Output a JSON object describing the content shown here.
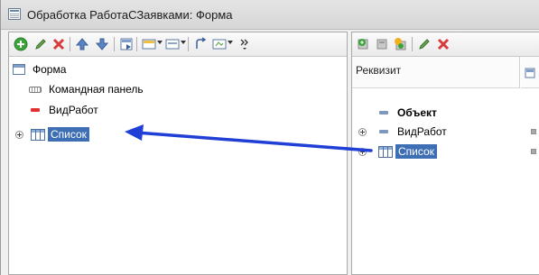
{
  "window": {
    "title": "Обработка РаботаСЗаявками: Форма"
  },
  "left_tree": {
    "items": [
      {
        "label": "Форма",
        "icon": "form-icon"
      },
      {
        "label": "Командная панель",
        "icon": "command-panel-icon"
      },
      {
        "label": "ВидРабот",
        "icon": "field-icon"
      },
      {
        "label": "Список",
        "icon": "table-icon",
        "selected": true
      }
    ]
  },
  "right_panel": {
    "column_header": "Реквизит",
    "items": [
      {
        "label": "Объект",
        "icon": "attribute-icon"
      },
      {
        "label": "ВидРабот",
        "icon": "attribute-icon"
      },
      {
        "label": "Список",
        "icon": "table-icon",
        "selected": true
      }
    ]
  },
  "toolbar_left": [
    "add-icon",
    "edit-icon",
    "delete-icon",
    "move-up-icon",
    "move-down-icon",
    "form-item-icon",
    "panel-icon",
    "group-icon",
    "link-icon",
    "field-icon",
    "more-icon"
  ],
  "toolbar_right": [
    "add-attribute-icon",
    "attribute-icon",
    "add-subattribute-icon",
    "edit-icon",
    "delete-icon"
  ],
  "colors": {
    "selection": "#3e6fb5",
    "arrow": "#1f3fd6",
    "delete": "#d83b3b",
    "add": "#3aa43a"
  }
}
